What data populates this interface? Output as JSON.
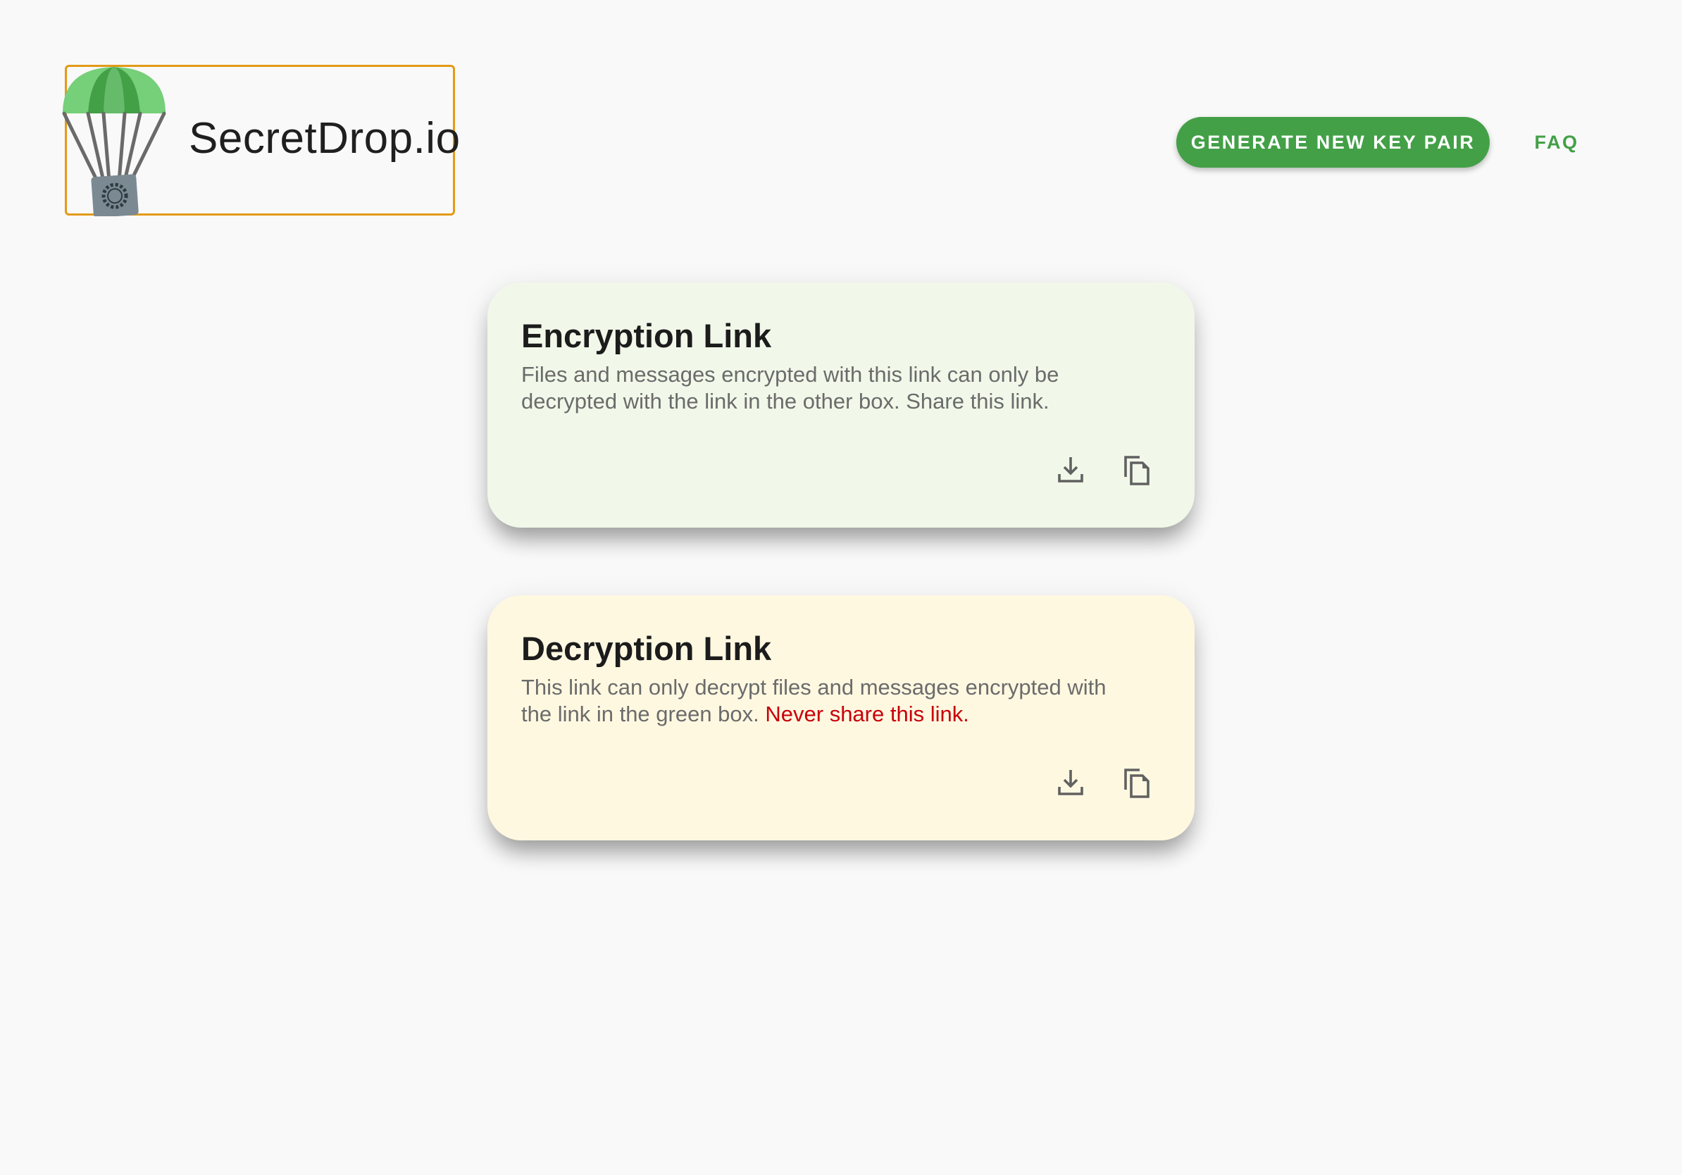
{
  "header": {
    "logo_text": "SecretDrop.io",
    "logo_icon": "parachute-safe-icon",
    "generate_label": "GENERATE NEW KEY PAIR",
    "faq_label": "FAQ"
  },
  "cards": {
    "encryption": {
      "title": "Encryption Link",
      "description": "Files and messages encrypted with this link can only be decrypted with the link in the other box. Share this link.",
      "download_icon": "download-icon",
      "copy_icon": "copy-icon"
    },
    "decryption": {
      "title": "Decryption Link",
      "description": "This link can only decrypt files and messages encrypted with the link in the green box. ",
      "warning": "Never share this link.",
      "download_icon": "download-icon",
      "copy_icon": "copy-icon"
    }
  },
  "colors": {
    "brand_green": "#43a047",
    "logo_border": "#e39a17",
    "encrypt_card_bg": "#f1f8e9",
    "decrypt_card_bg": "#fff8e1",
    "warning_red": "#c8000a"
  }
}
